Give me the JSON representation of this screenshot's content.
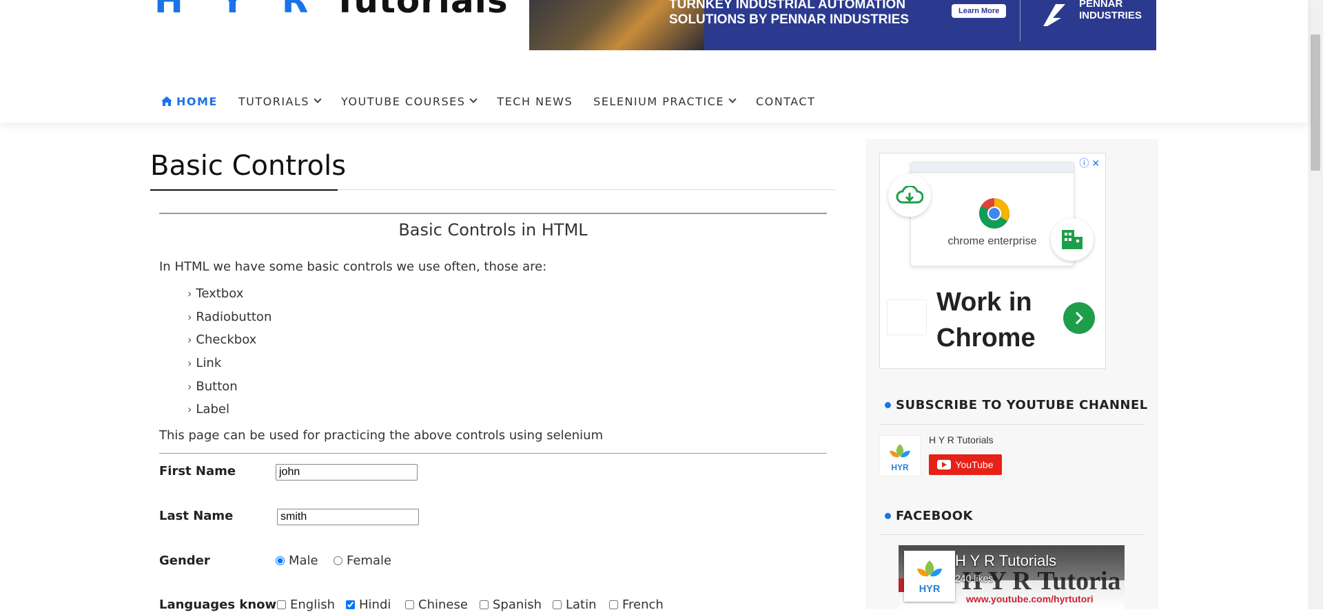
{
  "header": {
    "logo_hyr": "H Y R",
    "logo_tutorials": "Tutorials",
    "banner": {
      "headline_line1": "TURNKEY INDUSTRIAL AUTOMATION",
      "headline_line2": "SOLUTIONS BY PENNAR INDUSTRIES",
      "cta": "Learn More",
      "brand_line1": "PENNAR",
      "brand_line2": "INDUSTRIES"
    }
  },
  "nav": {
    "items": [
      {
        "label": "HOME",
        "active": true
      },
      {
        "label": "TUTORIALS",
        "dropdown": true
      },
      {
        "label": "YOUTUBE COURSES",
        "dropdown": true
      },
      {
        "label": "TECH NEWS"
      },
      {
        "label": "SELENIUM PRACTICE",
        "dropdown": true
      },
      {
        "label": "CONTACT"
      }
    ]
  },
  "main": {
    "page_title": "Basic Controls",
    "section_heading": "Basic Controls in HTML",
    "intro": "In HTML we have some basic controls we use often, those are:",
    "controls": [
      "Textbox",
      "Radiobutton",
      "Checkbox",
      "Link",
      "Button",
      "Label"
    ],
    "outro": "This page can be used for practicing the above controls using selenium",
    "form": {
      "first_name_label": "First Name",
      "first_name_value": "john",
      "last_name_label": "Last Name",
      "last_name_value": "smith",
      "gender_label": "Gender",
      "gender_options": [
        {
          "label": "Male",
          "checked": true
        },
        {
          "label": "Female",
          "checked": false
        }
      ],
      "languages_label": "Languages known",
      "languages": [
        {
          "label": "English",
          "checked": false
        },
        {
          "label": "Hindi",
          "checked": true
        },
        {
          "label": "Chinese",
          "checked": false
        },
        {
          "label": "Spanish",
          "checked": false
        },
        {
          "label": "Latin",
          "checked": false
        },
        {
          "label": "French",
          "checked": false
        }
      ]
    }
  },
  "sidebar": {
    "ad": {
      "screenshot_text": "chrome enterprise",
      "headline_line1": "Work in",
      "headline_line2": "Chrome",
      "info_icon": "info-icon",
      "close_icon": "close-icon"
    },
    "youtube": {
      "title": "SUBSCRIBE TO YOUTUBE CHANNEL",
      "channel_name": "H Y R Tutorials",
      "button_label": "YouTube"
    },
    "facebook": {
      "title": "FACEBOOK",
      "page_name": "H Y R Tutorials",
      "likes": "240 likes",
      "cover_text": "H Y R Tutoria",
      "cover_url": "www.youtube.com/hyrtutori"
    }
  },
  "colors": {
    "accent": "#1a73e8",
    "banner_bg": "#2b3a8f",
    "youtube_red": "#e62117",
    "ad_go_green": "#1e9e4a"
  }
}
